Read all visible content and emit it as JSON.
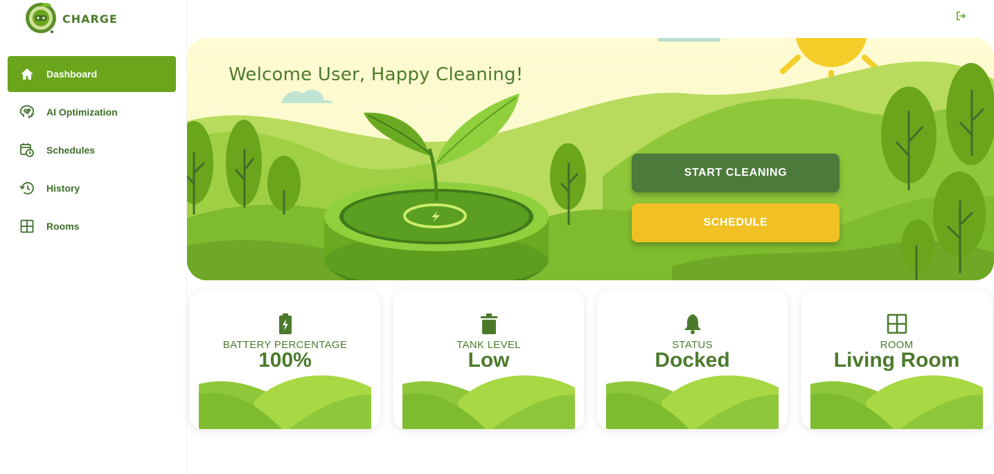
{
  "brand": {
    "name": "CHARGE"
  },
  "sidebar": {
    "items": [
      {
        "label": "Dashboard",
        "icon": "home-icon",
        "active": true
      },
      {
        "label": "AI Optimization",
        "icon": "brain-icon",
        "active": false
      },
      {
        "label": "Schedules",
        "icon": "calendar-clock-icon",
        "active": false
      },
      {
        "label": "History",
        "icon": "history-icon",
        "active": false
      },
      {
        "label": "Rooms",
        "icon": "grid-icon",
        "active": false
      }
    ]
  },
  "header": {
    "logout_icon": "logout-icon"
  },
  "hero": {
    "welcome": "Welcome User, Happy Cleaning!",
    "start_label": "START CLEANING",
    "schedule_label": "SCHEDULE"
  },
  "cards": [
    {
      "icon": "battery-icon",
      "label": "BATTERY PERCENTAGE",
      "value": "100%"
    },
    {
      "icon": "trash-icon",
      "label": "TANK LEVEL",
      "value": "Low"
    },
    {
      "icon": "bell-icon",
      "label": "STATUS",
      "value": "Docked"
    },
    {
      "icon": "grid-icon",
      "label": "ROOM",
      "value": "Living Room"
    }
  ],
  "colors": {
    "primary": "#6aa51c",
    "dark_green": "#4b7a3a",
    "text_green": "#4b7a2c",
    "yellow": "#f1c124"
  }
}
